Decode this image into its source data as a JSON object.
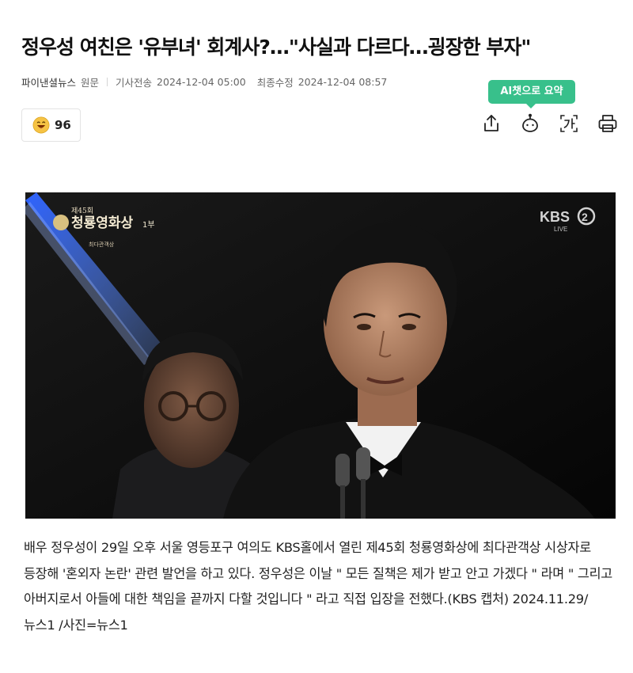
{
  "article": {
    "headline": "정우성 여친은 '유부녀' 회계사?…\"사실과 다르다…굉장한 부자\"",
    "source": "파이낸셜뉴스",
    "source_link": "원문",
    "published_label": "기사전송",
    "published": "2024-12-04 05:00",
    "modified_label": "최종수정",
    "modified": "2024-12-04 08:57"
  },
  "reaction": {
    "icon": "laugh-face-icon",
    "count": "96"
  },
  "ai_tooltip": "AI챗으로 요약",
  "toolbar": {
    "icons": [
      "share-icon",
      "ai-chat-icon",
      "font-size-icon",
      "print-icon"
    ]
  },
  "photo": {
    "broadcaster": "KBS",
    "broadcaster_channel": "2",
    "live": "LIVE",
    "event_num": "제45회",
    "event_title": "청룡영화상",
    "event_part": "1부",
    "event_sub": "최다관객상"
  },
  "caption": "배우 정우성이 29일 오후 서울 영등포구 여의도 KBS홀에서 열린 제45회 청룡영화상에 최다관객상 시상자로 등장해 '혼외자 논란' 관련 발언을 하고 있다. 정우성은 이날  \" 모든 질책은 제가 받고 안고 가겠다 \" 라며  \" 그리고 아버지로서 아들에 대한 책임을 끝까지 다할 것입니다 \" 라고 직접 입장을 전했다.(KBS 캡처) 2024.11.29/뉴스1 /사진=뉴스1",
  "colors": {
    "accent": "#38c08b",
    "text": "#111111",
    "meta": "#666666"
  }
}
